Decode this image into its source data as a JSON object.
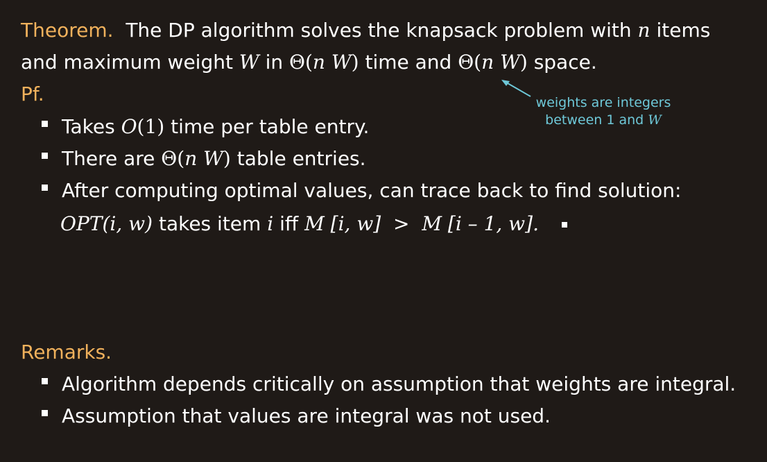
{
  "theorem": {
    "heading": "Theorem.",
    "t1": "The DP algorithm solves the knapsack problem with",
    "n": "n",
    "t2": "items",
    "t3": "and maximum weight",
    "W": "W",
    "t4": "in",
    "theta_time": "Θ(",
    "nW_time_n": "n",
    "nW_time_W": "W",
    "close1": ")",
    "t5": "time and",
    "theta_space": "Θ(",
    "nW_space_n": "n",
    "nW_space_W": "W",
    "close2": ")",
    "t6": "space."
  },
  "proof": {
    "heading": "Pf.",
    "bullet1_a": "Takes",
    "bullet1_math": "O",
    "bullet1_paren": "(1)",
    "bullet1_b": "time per table entry.",
    "bullet2_a": "There are",
    "bullet2_theta": "Θ(",
    "bullet2_n": "n",
    "bullet2_W": "W",
    "bullet2_close": ")",
    "bullet2_b": "table entries.",
    "bullet3": "After computing optimal values, can trace back to find solution:",
    "opt_math": "OPT",
    "opt_args": "(i, w)",
    "opt_text1": "takes item",
    "opt_i": "i",
    "opt_text2": "iff",
    "opt_M1": "M",
    "opt_M1_args": "[i, w]",
    "opt_gt": ">",
    "opt_M2": "M",
    "opt_M2_args": "[i – 1, w].",
    "note_line1": "weights are integers",
    "note_line2_a": "between 1 and",
    "note_line2_W": "W"
  },
  "remarks": {
    "heading": "Remarks.",
    "bullet1": "Algorithm depends critically on assumption that weights are integral.",
    "bullet2": "Assumption that values are integral was not used."
  },
  "colors": {
    "background": "#1f1a17",
    "heading": "#f0b15c",
    "text": "#ffffff",
    "annotation": "#6ec8d8"
  }
}
